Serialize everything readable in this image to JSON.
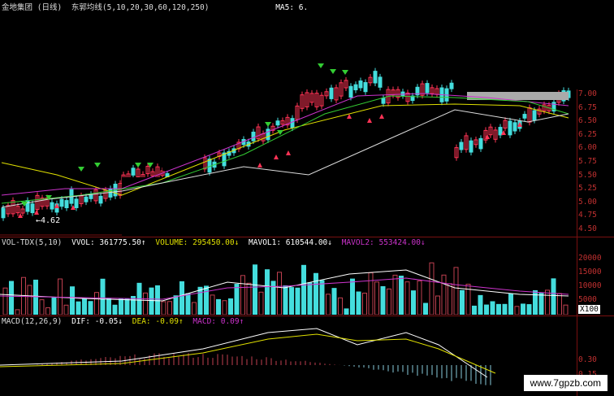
{
  "price_panel": {
    "title": "金地集团 (日线)",
    "indicator": "东郭均线(5,10,20,30,60,120,250)",
    "ma5_label": "MA5: 6.",
    "low_marker": "4.62",
    "yticks": [
      "7.00",
      "6.75",
      "6.50",
      "6.25",
      "6.00",
      "5.75",
      "5.50",
      "5.25",
      "5.00",
      "4.75",
      "4.50"
    ]
  },
  "volume_panel": {
    "title": "VOL-TDX(5,10)",
    "vvol": "VVOL: 361775.50↑",
    "volume": "VOLUME: 295450.00↓",
    "mavol1": "MAVOL1: 610544.00↓",
    "mavol2": "MAVOL2: 553424.00↓",
    "yticks": [
      "20000",
      "15000",
      "10000",
      "5000"
    ],
    "unit": "X100"
  },
  "macd_panel": {
    "title": "MACD(12,26,9)",
    "dif": "DIF: -0.05↓",
    "dea": "DEA: -0.09↑",
    "macd": "MACD: 0.09↑",
    "yticks": [
      "0.30",
      "0.15"
    ]
  },
  "watermark": "www.7gpzb.com",
  "colors": {
    "up": "#ff3355",
    "down": "#44dddd",
    "grid": "#7a1010",
    "yellow": "#e0e000",
    "magenta": "#cc33cc",
    "green": "#33cc33"
  }
}
